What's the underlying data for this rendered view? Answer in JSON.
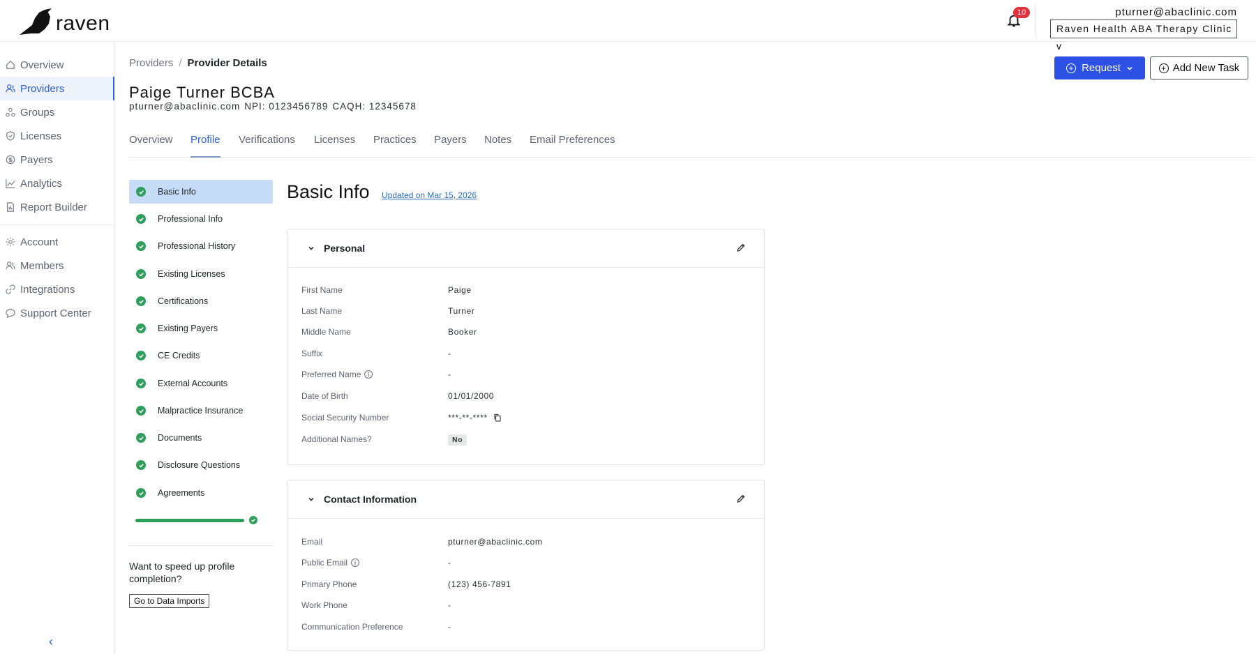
{
  "app": {
    "name": "raven"
  },
  "header": {
    "notification_count": "10",
    "user_email": "pturner@abaclinic.com",
    "clinic_select": "Raven Health ABA Therapy Clinic v"
  },
  "sidebar": {
    "primary": [
      {
        "label": "Overview",
        "icon": "home-icon"
      },
      {
        "label": "Providers",
        "icon": "providers-icon",
        "active": true
      },
      {
        "label": "Groups",
        "icon": "groups-icon"
      },
      {
        "label": "Licenses",
        "icon": "shield-icon"
      },
      {
        "label": "Payers",
        "icon": "dollar-icon"
      },
      {
        "label": "Analytics",
        "icon": "analytics-icon"
      },
      {
        "label": "Report Builder",
        "icon": "report-icon"
      }
    ],
    "secondary": [
      {
        "label": "Account",
        "icon": "gear-icon"
      },
      {
        "label": "Members",
        "icon": "members-icon"
      },
      {
        "label": "Integrations",
        "icon": "link-icon"
      },
      {
        "label": "Support Center",
        "icon": "chat-icon"
      }
    ],
    "collapse_glyph": "‹"
  },
  "breadcrumb": {
    "parent": "Providers",
    "separator": "/",
    "current": "Provider Details"
  },
  "provider": {
    "name": "Paige Turner BCBA",
    "email": "pturner@abaclinic.com",
    "npi": "NPI: 0123456789",
    "caqh": "CAQH: 12345678"
  },
  "actions": {
    "request": "Request",
    "add_task": "Add New Task"
  },
  "tabs": [
    {
      "label": "Overview"
    },
    {
      "label": "Profile",
      "active": true
    },
    {
      "label": "Verifications"
    },
    {
      "label": "Licenses"
    },
    {
      "label": "Practices"
    },
    {
      "label": "Payers"
    },
    {
      "label": "Notes"
    },
    {
      "label": "Email Preferences"
    }
  ],
  "steps": [
    "Basic Info",
    "Professional Info",
    "Professional History",
    "Existing Licenses",
    "Certifications",
    "Existing Payers",
    "CE Credits",
    "External Accounts",
    "Malpractice Insurance",
    "Documents",
    "Disclosure Questions",
    "Agreements"
  ],
  "steps_active": "Basic Info",
  "progress": {
    "percent": 100,
    "status_color": "#2e9e5b"
  },
  "speedup": {
    "text": "Want to speed up profile completion?",
    "button": "Go to Data Imports"
  },
  "basic_info": {
    "title": "Basic Info",
    "updated": "Updated on Mar 15, 2026",
    "personal": {
      "title": "Personal",
      "rows": [
        {
          "label": "First Name",
          "value": "Paige"
        },
        {
          "label": "Last Name",
          "value": "Turner"
        },
        {
          "label": "Middle Name",
          "value": "Booker"
        },
        {
          "label": "Suffix",
          "value": "-"
        },
        {
          "label": "Preferred Name",
          "value": "-",
          "info": true
        },
        {
          "label": "Date of Birth",
          "value": "01/01/2000"
        },
        {
          "label": "Social Security Number",
          "value": "***-**-****",
          "copy": true
        },
        {
          "label": "Additional Names?",
          "value": "No",
          "pill": true
        }
      ]
    },
    "contact": {
      "title": "Contact Information",
      "rows": [
        {
          "label": "Email",
          "value": "pturner@abaclinic.com"
        },
        {
          "label": "Public Email",
          "value": "-",
          "info": true
        },
        {
          "label": "Primary Phone",
          "value": "(123) 456-7891"
        },
        {
          "label": "Work Phone",
          "value": "-"
        },
        {
          "label": "Communication Preference",
          "value": "-"
        }
      ]
    }
  },
  "colors": {
    "accent": "#2b5fd9",
    "primary_button": "#2d51e4",
    "success": "#2e9e5b",
    "badge": "#e0323c",
    "active_step": "#c7dcf7"
  }
}
